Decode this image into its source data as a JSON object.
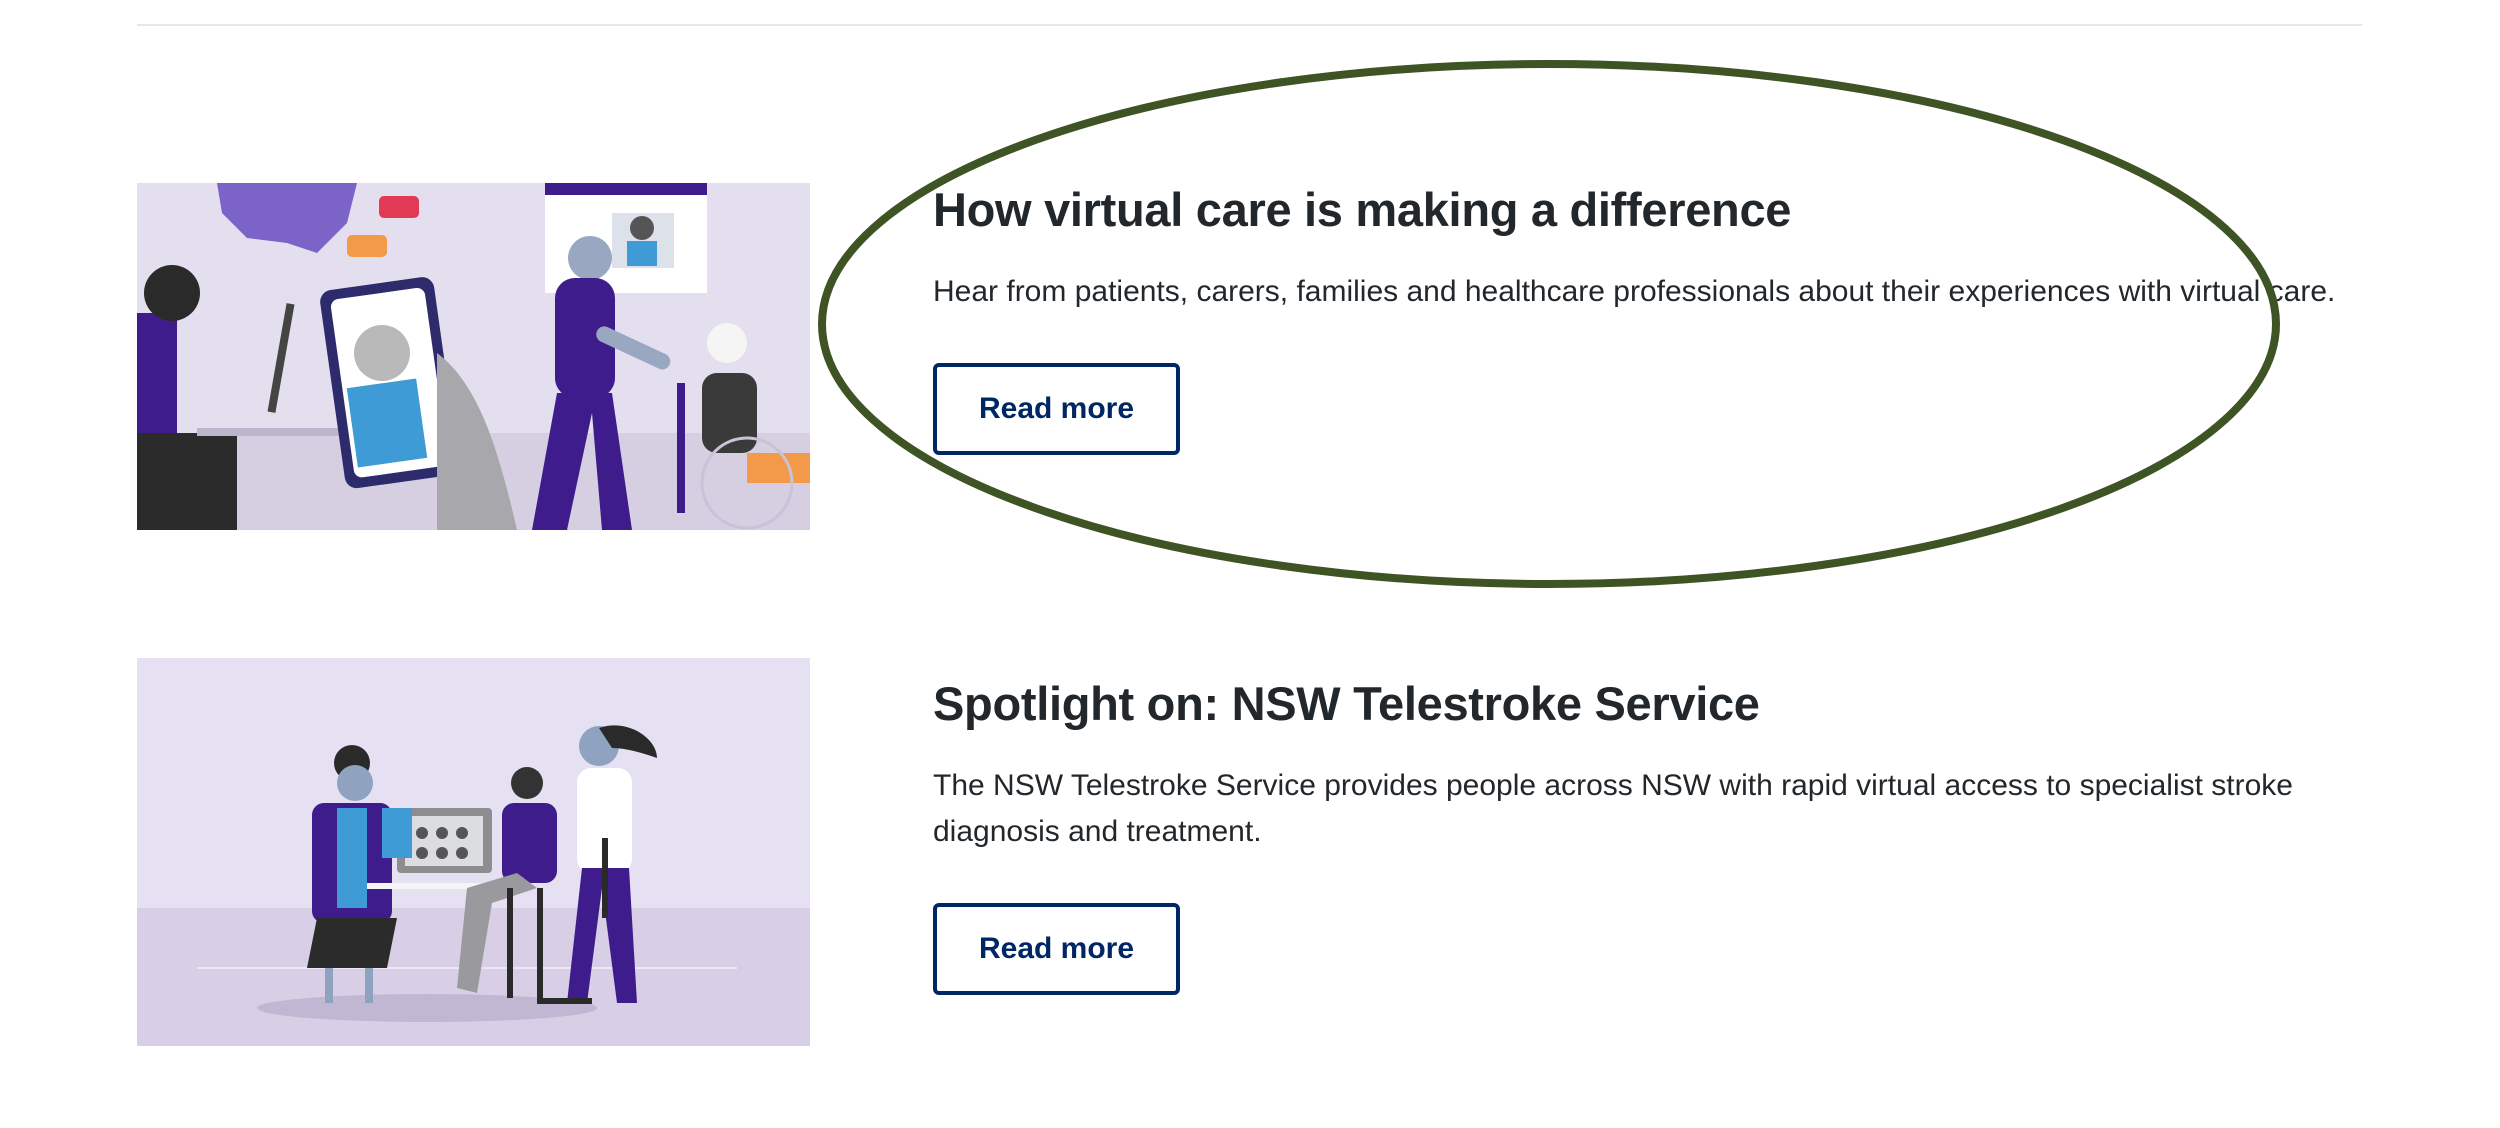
{
  "articles": [
    {
      "title": "How virtual care is making a difference",
      "description": "Hear from patients, carers, families and healthcare professionals about their experiences with virtual care.",
      "button_label": "Read more",
      "image_icon": "virtual-care-illustration"
    },
    {
      "title": "Spotlight on: NSW Telestroke Service",
      "description": "The NSW Telestroke Service provides people across NSW with rapid virtual access to specialist stroke diagnosis and treatment.",
      "button_label": "Read more",
      "image_icon": "telestroke-team-illustration"
    }
  ],
  "colors": {
    "primary_button": "#002664",
    "text": "#22272b",
    "annotation": "#3f5424",
    "illustration_purple": "#3f1c8c",
    "illustration_bg": "#e6e0f3"
  }
}
